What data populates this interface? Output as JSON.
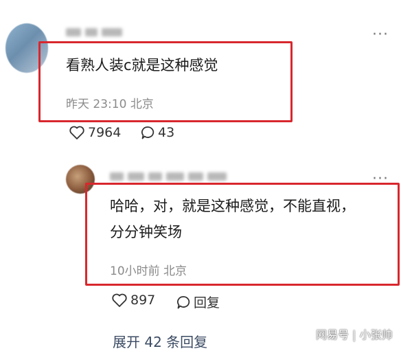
{
  "comments": [
    {
      "text": "看熟人装c就是这种感觉",
      "time": "昨天 23:10",
      "location": "北京",
      "likes": "7964",
      "reply_count": "43"
    }
  ],
  "reply": {
    "line1": "哈哈，对，就是这种感觉，不能直视，",
    "line2": "分分钟笑场",
    "time": "10小时前",
    "location": "北京",
    "likes": "897",
    "reply_label": "回复"
  },
  "expand_label": "展开 42 条回复",
  "watermark": "网易号 | 小张帅",
  "colors": {
    "highlight_box": "#d8272d",
    "meta_text": "#8a8a8a"
  }
}
